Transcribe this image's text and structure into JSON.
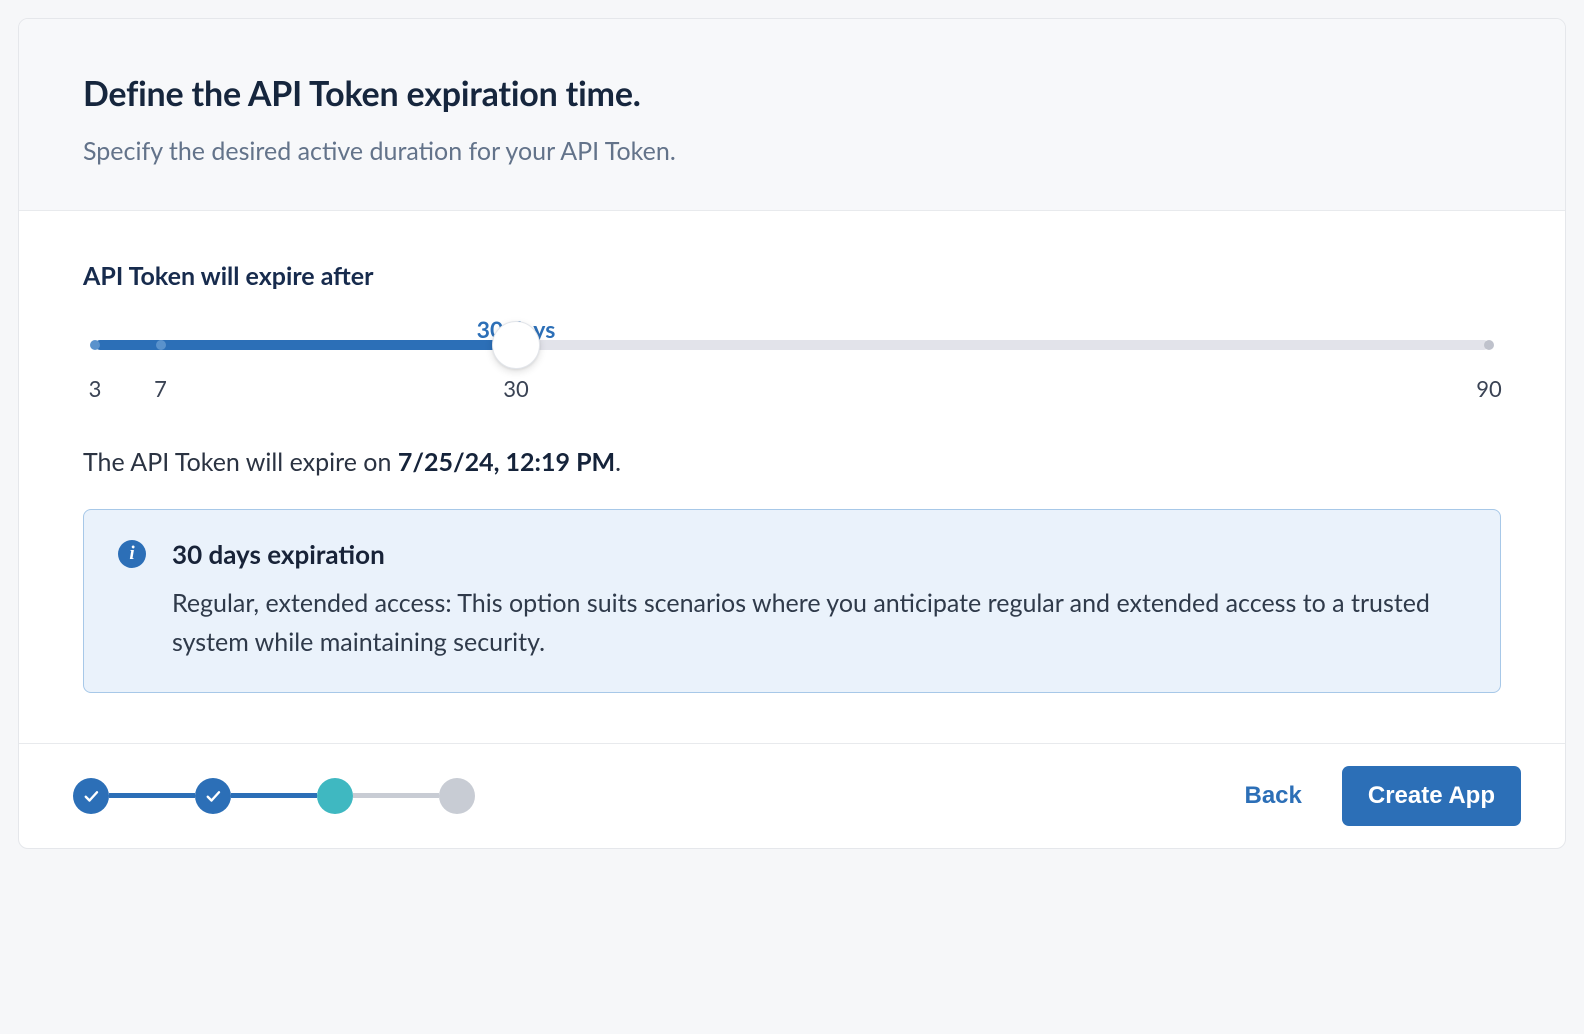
{
  "header": {
    "title": "Define the API Token expiration time.",
    "subtitle": "Specify the desired active duration for your API Token."
  },
  "slider": {
    "label": "API Token will expire after",
    "current_value_label": "30 days",
    "current_percent": 30.2,
    "stops": [
      {
        "value": "3",
        "percent": 0
      },
      {
        "value": "7",
        "percent": 4.7
      },
      {
        "value": "30",
        "percent": 30.2
      },
      {
        "value": "90",
        "percent": 100
      }
    ]
  },
  "expire_sentence": {
    "prefix": "The API Token will expire on ",
    "bold": "7/25/24, 12:19 PM",
    "suffix": "."
  },
  "callout": {
    "title": "30 days expiration",
    "body": "Regular, extended access: This option suits scenarios where you anticipate regular and extended access to a trusted system while maintaining security."
  },
  "stepper": {
    "steps": [
      {
        "state": "done"
      },
      {
        "state": "done"
      },
      {
        "state": "current"
      },
      {
        "state": "future"
      }
    ]
  },
  "footer": {
    "back_label": "Back",
    "primary_label": "Create App"
  }
}
